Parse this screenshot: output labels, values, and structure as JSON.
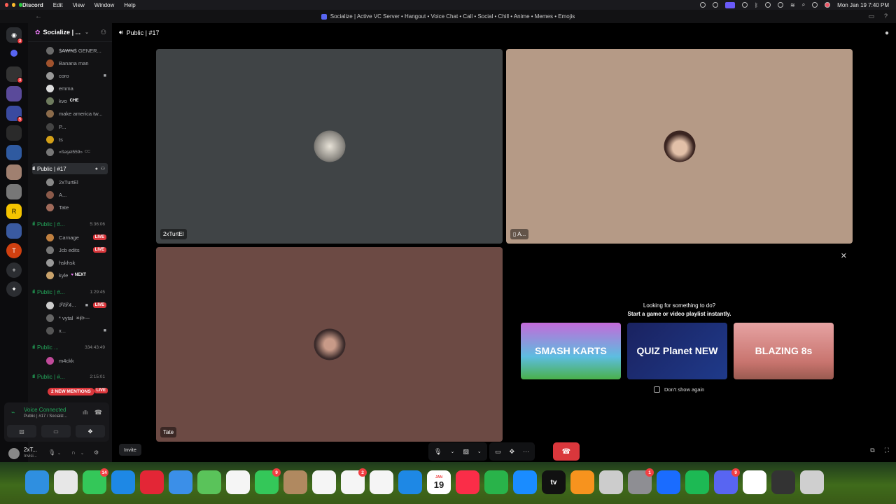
{
  "menubar": {
    "app_name": "Discord",
    "menus": [
      "Edit",
      "View",
      "Window",
      "Help"
    ],
    "clock": "Mon Jan 19  7:40 PM"
  },
  "window": {
    "title": "Socialize | Active VC Server • Hangout • Voice Chat • Call • Social • Chill • Anime • Memes • Emojis"
  },
  "server_list": {
    "badges": [
      "3",
      "3",
      "5"
    ]
  },
  "sidebar": {
    "server_name": "Socialize | ...",
    "members_top": [
      {
        "name": "$₳₩₦$ GENER...",
        "color": "#6b6b6b"
      },
      {
        "name": "Banana man",
        "color": "#a0522d"
      },
      {
        "name": "coro",
        "color": "#999999",
        "icon": "video"
      },
      {
        "name": "emma",
        "color": "#dddddd"
      },
      {
        "name": "kvo",
        "color": "#6e7b5e",
        "tag": "CHE"
      },
      {
        "name": "make america tw...",
        "color": "#8b6b4b"
      },
      {
        "name": "P...",
        "color": "#444444"
      },
      {
        "name": "ts",
        "color": "#d4a017"
      },
      {
        "name": "«ßaşel559»",
        "color": "#777777",
        "tag": "CC"
      }
    ],
    "voice_channels": [
      {
        "name": "Public | #17",
        "active": true,
        "members": [
          {
            "name": "2xTurtEl",
            "color": "#888888"
          },
          {
            "name": "A...",
            "color": "#8b5a4a"
          },
          {
            "name": "Tate",
            "color": "#a06a5a"
          }
        ]
      },
      {
        "name": "Public | #...",
        "time": "5:36:06",
        "members": [
          {
            "name": "Carnage",
            "color": "#c08040",
            "live": "LIVE"
          },
          {
            "name": "Jcb edits",
            "color": "#777777",
            "live": "LIVE"
          },
          {
            "name": "hskhsk",
            "color": "#999999"
          },
          {
            "name": "kyle",
            "color": "#c9a26b",
            "tag": "NEXT"
          }
        ]
      },
      {
        "name": "Public | #...",
        "time": "1:29:45",
        "members": [
          {
            "name": "𝒮𝓁𝒯𝒽...",
            "color": "#cccccc",
            "live": "LIVE"
          },
          {
            "name": "* vytal",
            "color": "#666666",
            "tag": "☠∮⊱—"
          },
          {
            "name": "x...",
            "color": "#555555"
          }
        ]
      },
      {
        "name": "Public ...",
        "time": "334:43:49",
        "members": [
          {
            "name": "m4ckk",
            "color": "#c04a9a"
          }
        ]
      },
      {
        "name": "Public | #...",
        "time": "2:15:01",
        "members": []
      }
    ],
    "mentions_banner": "2 NEW MENTIONS",
    "live_label": "LIVE"
  },
  "voice_panel": {
    "status": "Voice Connected",
    "channel": "Public | #17 / Socializ..."
  },
  "user_panel": {
    "name": "2xT...",
    "status": "Invisi..."
  },
  "main": {
    "channel_title": "Public | #17",
    "tiles": [
      {
        "name": "2xTurtEl",
        "bg": "#404446"
      },
      {
        "name": "A...",
        "bg": "#b59a86"
      },
      {
        "name": "Tate",
        "bg": "#6c4a44"
      }
    ],
    "activity": {
      "line1": "Looking for something to do?",
      "line2": "Start a game or video playlist instantly.",
      "games": [
        "SMASH KARTS",
        "QUIZ Planet NEW",
        "BLAZING 8s"
      ],
      "dont_show": "Don't show again"
    },
    "invite_label": "Invite"
  },
  "dock": {
    "apps": [
      {
        "name": "Finder",
        "color": "#2f8fe0"
      },
      {
        "name": "Launchpad",
        "color": "#e7e7e7"
      },
      {
        "name": "Messages",
        "color": "#34c759",
        "badge": "14"
      },
      {
        "name": "Safari",
        "color": "#1e88e5"
      },
      {
        "name": "Opera",
        "color": "#e32636"
      },
      {
        "name": "Mail",
        "color": "#3b8fe8"
      },
      {
        "name": "Maps",
        "color": "#5ac35a"
      },
      {
        "name": "Photos",
        "color": "#f5f5f5"
      },
      {
        "name": "FaceTime",
        "color": "#34c759",
        "badge": "9"
      },
      {
        "name": "Contacts",
        "color": "#b08960"
      },
      {
        "name": "Freeform",
        "color": "#f5f5f5"
      },
      {
        "name": "Reminders",
        "color": "#f5f5f5",
        "badge": "2"
      },
      {
        "name": "News",
        "color": "#f5f5f5"
      },
      {
        "name": "Keynote",
        "color": "#1e88e5"
      },
      {
        "name": "Calendar",
        "color": "#ffffff",
        "month": "JAN",
        "day": "19"
      },
      {
        "name": "Music",
        "color": "#fa2d48"
      },
      {
        "name": "Numbers",
        "color": "#29b34a"
      },
      {
        "name": "App Store",
        "color": "#1a8cff"
      },
      {
        "name": "TV",
        "color": "#111111",
        "label": "tv"
      },
      {
        "name": "Pages",
        "color": "#f7931e"
      },
      {
        "name": "iPhone Mirroring",
        "color": "#cccccc"
      },
      {
        "name": "System Settings",
        "color": "#8e8e93",
        "badge": "1"
      },
      {
        "name": "Roblox",
        "color": "#1a6cff"
      },
      {
        "name": "Spotify",
        "color": "#1db954"
      },
      {
        "name": "Discord",
        "color": "#5865f2",
        "badge": "9"
      },
      {
        "name": "Chrome",
        "color": "#ffffff"
      },
      {
        "name": "OBS",
        "color": "#333333"
      },
      {
        "name": "Trash",
        "color": "#cfcfcf"
      }
    ]
  }
}
